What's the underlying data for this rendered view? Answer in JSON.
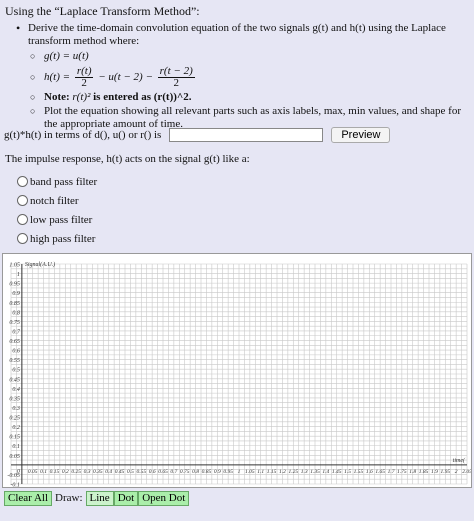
{
  "header": {
    "title": "Using the “Laplace Transform Method”:"
  },
  "bullets": {
    "b1": "Derive the time-domain convolution equation of the two signals g(t) and h(t) using the Laplace transform method where:",
    "g_eq": "g(t) = u(t)",
    "h_lhs": "h(t) =",
    "h_f1_num": "r(t)",
    "h_f1_den": "2",
    "h_mid": "− u(t − 2) −",
    "h_f2_num": "r(t − 2)",
    "h_f2_den": "2",
    "note_prefix": "Note:",
    "note_math": "r(t)²",
    "note_suffix": "is entered as (r(t))^2.",
    "plot": "Plot the equation showing all relevant parts such as axis labels, max, min values, and shape for the appropriate amount of time."
  },
  "answer": {
    "label": "g(t)*h(t) in terms of d(), u() or r() is",
    "value": "",
    "preview_label": "Preview"
  },
  "question": {
    "text": "The impulse response, h(t) acts on the signal g(t) like a:",
    "options": [
      "band pass filter",
      "notch filter",
      "low pass filter",
      "high pass filter"
    ]
  },
  "graph": {
    "y_axis_label": "Signal(A.U.)",
    "x_axis_label": "time(",
    "y_ticks": [
      "1.05",
      "1",
      "0.95",
      "0.9",
      "0.85",
      "0.8",
      "0.75",
      "0.7",
      "0.65",
      "0.6",
      "0.55",
      "0.5",
      "0.45",
      "0.4",
      "0.35",
      "0.3",
      "0.25",
      "0.2",
      "0.15",
      "0.1",
      "0.05",
      "-0.05",
      "-0.1"
    ],
    "x_ticks": [
      "0.05",
      "0.1",
      "0.15",
      "0.2",
      "0.25",
      "0.3",
      "0.35",
      "0.4",
      "0.45",
      "0.5",
      "0.55",
      "0.6",
      "0.65",
      "0.7",
      "0.75",
      "0.8",
      "0.85",
      "0.9",
      "0.95",
      "1",
      "1.05",
      "1.1",
      "1.15",
      "1.2",
      "1.25",
      "1.3",
      "1.35",
      "1.4",
      "1.45",
      "1.5",
      "1.55",
      "1.6",
      "1.65",
      "1.7",
      "1.75",
      "1.8",
      "1.85",
      "1.9",
      "1.95",
      "2",
      "2.05"
    ],
    "origin_label": "0",
    "xlim": [
      -0.05,
      2.05
    ],
    "ylim": [
      -0.1,
      1.05
    ],
    "grid": true
  },
  "toolbar": {
    "clear_label": "Clear All",
    "draw_label": "Draw:",
    "line_label": "Line",
    "dot_label": "Dot",
    "open_dot_label": "Open Dot"
  }
}
